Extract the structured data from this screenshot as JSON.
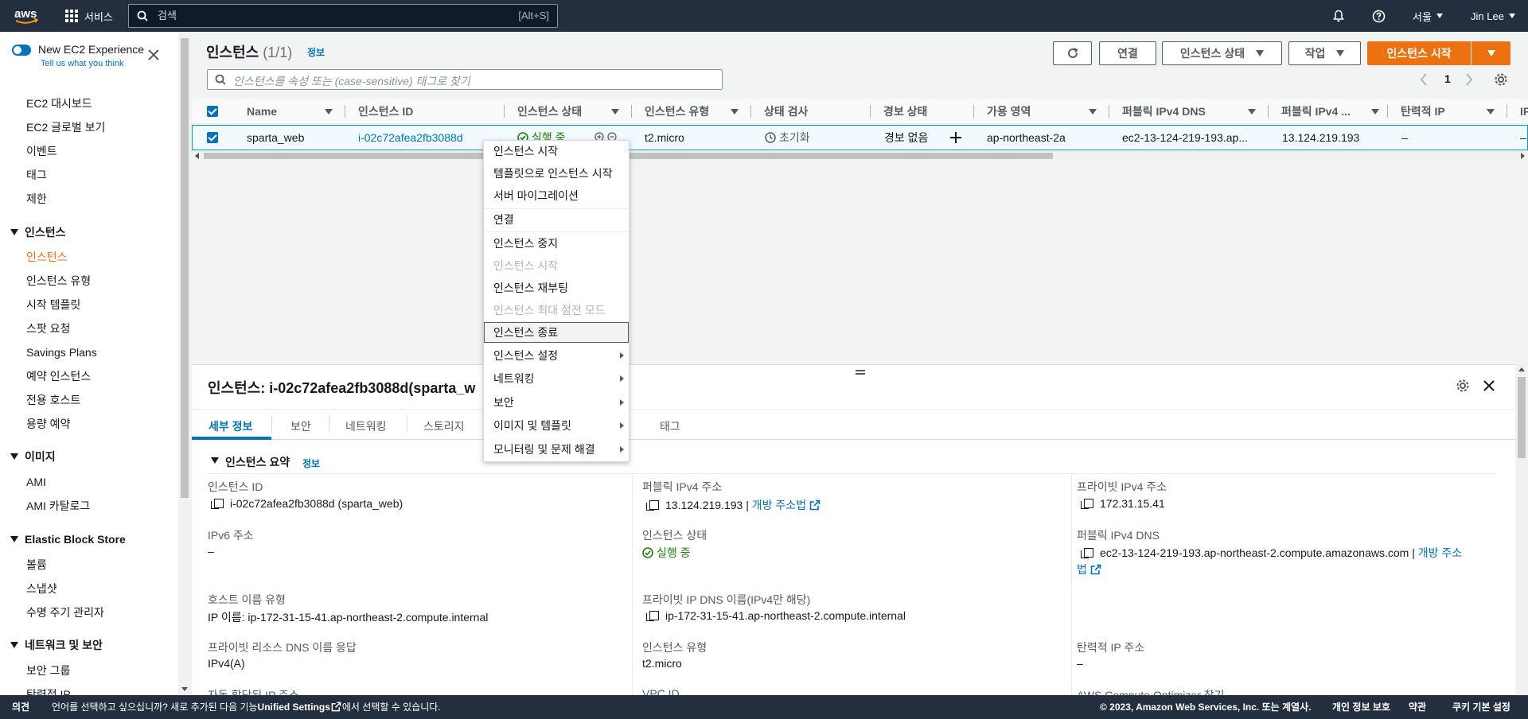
{
  "topnav": {
    "services_label": "서비스",
    "search_placeholder": "검색",
    "search_shortcut": "[Alt+S]",
    "region": "서울",
    "user": "Jin Lee"
  },
  "sidebar": {
    "new_experience_label": "New EC2 Experience",
    "new_experience_sub": "Tell us what you think",
    "top_items": [
      "EC2 대시보드",
      "EC2 글로벌 보기",
      "이벤트",
      "태그",
      "제한"
    ],
    "sections": [
      {
        "title": "인스턴스",
        "items": [
          "인스턴스",
          "인스턴스 유형",
          "시작 템플릿",
          "스팟 요청",
          "Savings Plans",
          "예약 인스턴스",
          "전용 호스트",
          "용량 예약"
        ]
      },
      {
        "title": "이미지",
        "items": [
          "AMI",
          "AMI 카탈로그"
        ]
      },
      {
        "title": "Elastic Block Store",
        "items": [
          "볼륨",
          "스냅샷",
          "수명 주기 관리자"
        ]
      },
      {
        "title": "네트워크 및 보안",
        "items": [
          "보안 그룹",
          "탄력적 IP"
        ]
      }
    ],
    "active_item": "인스턴스"
  },
  "header": {
    "title": "인스턴스",
    "count": "(1/1)",
    "info": "정보",
    "connect": "연결",
    "state_btn": "인스턴스 상태",
    "actions_btn": "작업",
    "launch_btn": "인스턴스 시작",
    "filter_placeholder": "인스턴스를 속성 또는 (case-sensitive) 태그로 찾기",
    "page": "1"
  },
  "table": {
    "columns": [
      "Name",
      "인스턴스 ID",
      "인스턴스 상태",
      "인스턴스 유형",
      "상태 검사",
      "경보 상태",
      "가용 영역",
      "퍼블릭 IPv4 DNS",
      "퍼블릭 IPv4 ...",
      "탄력적 IP",
      "IF"
    ],
    "row": {
      "name": "sparta_web",
      "id": "i-02c72afea2fb3088d",
      "state": "실행 중",
      "type": "t2.micro",
      "check": "초기화",
      "alarm": "경보 없음",
      "az": "ap-northeast-2a",
      "dns": "ec2-13-124-219-193.ap...",
      "ipv4": "13.124.219.193",
      "eip": "–",
      "last": "–"
    }
  },
  "context_menu": {
    "items": [
      {
        "label": "인스턴스 시작",
        "disabled": false
      },
      {
        "label": "템플릿으로 인스턴스 시작",
        "disabled": false
      },
      {
        "label": "서버 마이그레이션",
        "disabled": false
      },
      {
        "label": "연결",
        "disabled": false
      },
      {
        "label": "인스턴스 중지",
        "disabled": false
      },
      {
        "label": "인스턴스 시작",
        "disabled": true
      },
      {
        "label": "인스턴스 재부팅",
        "disabled": false
      },
      {
        "label": "인스턴스 최대 절전 모드",
        "disabled": true
      },
      {
        "label": "인스턴스 종료",
        "disabled": false,
        "highlighted": true
      },
      {
        "label": "인스턴스 설정",
        "submenu": true
      },
      {
        "label": "네트워킹",
        "submenu": true
      },
      {
        "label": "보안",
        "submenu": true
      },
      {
        "label": "이미지 및 템플릿",
        "submenu": true
      },
      {
        "label": "모니터링 및 문제 해결",
        "submenu": true
      }
    ]
  },
  "detail": {
    "title": "인스턴스: i-02c72afea2fb3088d(sparta_w",
    "tabs": [
      "세부 정보",
      "보안",
      "네트워킹",
      "스토리지",
      "태그"
    ],
    "active_tab": "세부 정보",
    "summary": "인스턴스 요약",
    "summary_info": "정보",
    "fields": {
      "instance_id_label": "인스턴스 ID",
      "instance_id": "i-02c72afea2fb3088d (sparta_web)",
      "ipv6_label": "IPv6 주소",
      "ipv6": "–",
      "hostname_type_label": "호스트 이름 유형",
      "hostname_type": "IP 이름: ip-172-31-15-41.ap-northeast-2.compute.internal",
      "private_dns_resp_label": "프라이빗 리소스 DNS 이름 응답",
      "private_dns_resp": "IPv4(A)",
      "auto_ip_label": "자동 할당된 IP 주소",
      "public_ipv4_label": "퍼블릭 IPv4 주소",
      "public_ipv4": "13.124.219.193",
      "open_address": "개방 주소법",
      "state_label": "인스턴스 상태",
      "state": "실행 중",
      "private_dns_label": "프라이빗 IP DNS 이름(IPv4만 해당)",
      "private_dns": "ip-172-31-15-41.ap-northeast-2.compute.internal",
      "type_label": "인스턴스 유형",
      "type": "t2.micro",
      "vpc_label": "VPC ID",
      "private_ipv4_label": "프라이빗 IPv4 주소",
      "private_ipv4": "172.31.15.41",
      "public_dns_label": "퍼블릭 IPv4 DNS",
      "public_dns": "ec2-13-124-219-193.ap-northeast-2.compute.amazonaws.com",
      "open_address_1": "개방 주소",
      "open_address_2": "법",
      "eip_label": "탄력적 IP 주소",
      "eip": "–",
      "optimizer_label": "AWS Compute Optimizer 찾기"
    }
  },
  "footer": {
    "feedback": "의견",
    "lang_text_1": "언어를 선택하고 싶으십니까? 새로 추가된 다음 기능",
    "lang_link": "Unified Settings",
    "lang_text_2": "에서 선택할 수 있습니다.",
    "copyright": "© 2023, Amazon Web Services, Inc. 또는 계열사.",
    "privacy": "개인 정보 보호",
    "terms": "약관",
    "cookies": "쿠키 기본 설정"
  }
}
